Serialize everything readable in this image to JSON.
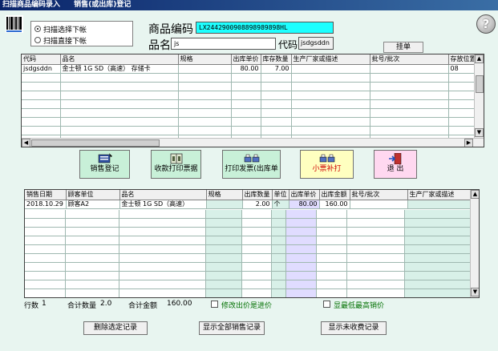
{
  "window": {
    "title_left": "扫描商品编码录入",
    "title_right": "销售(或出库)登记"
  },
  "help": {
    "label": "?"
  },
  "radio": {
    "option1": "扫描选择下帐",
    "option2": "扫描直接下帐"
  },
  "product": {
    "code_label": "商品编码",
    "code_value": "LX2442900908898989898HL",
    "name_label": "品名",
    "name_value": "js",
    "dm_label": "代码",
    "dm_value": "jsdgsddn",
    "hang_label": "挂单"
  },
  "stock_grid": {
    "columns": [
      "代码",
      "品名",
      "规格",
      "出库单价",
      "库存数量",
      "生产厂家或描述",
      "批号/批次",
      "存放位置"
    ],
    "rows": [
      [
        "jsdgsddn",
        "金士顿 1G SD（高速） 存储卡",
        "",
        "80.00",
        "7.00",
        "",
        "",
        "08"
      ]
    ]
  },
  "buttons": {
    "sale_register": "销售登记",
    "print_receipt": "收款打印票据",
    "print_invoice": "打印发票(出库单",
    "small_ticket": "小票补打",
    "exit": "退 出"
  },
  "sales_grid": {
    "columns": [
      "销售日期",
      "顾客单位",
      "品名",
      "规格",
      "出库数量",
      "单位",
      "出库单价",
      "出库金额",
      "批号/批次",
      "生产厂家或描述"
    ],
    "rows": [
      [
        "2018.10.29",
        "顾客A2",
        "金士顿 1G SD（高速）",
        "",
        "2.00",
        "个",
        "80.00",
        "160.00",
        "",
        ""
      ]
    ]
  },
  "totals": {
    "row_count_label": "行数",
    "row_count": "1",
    "qty_label": "合计数量",
    "qty": "2.0",
    "amount_label": "合计金额",
    "amount": "160.00",
    "modify_price_label": "修改出价是进价",
    "show_lowest_label": "显最低最高销价"
  },
  "bottom_buttons": {
    "delete_selected": "删除选定记录",
    "show_all": "显示全部销售记录",
    "show_unpaid": "显示未收费记录"
  },
  "colors": {
    "code_bg": "#1dffff",
    "panel_bg": "#e8f5f0",
    "btn_green": "#c8f0d8",
    "btn_yellow": "#ffffc0",
    "btn_pink": "#ffd8f0",
    "col_purple": "#e0dcff"
  }
}
